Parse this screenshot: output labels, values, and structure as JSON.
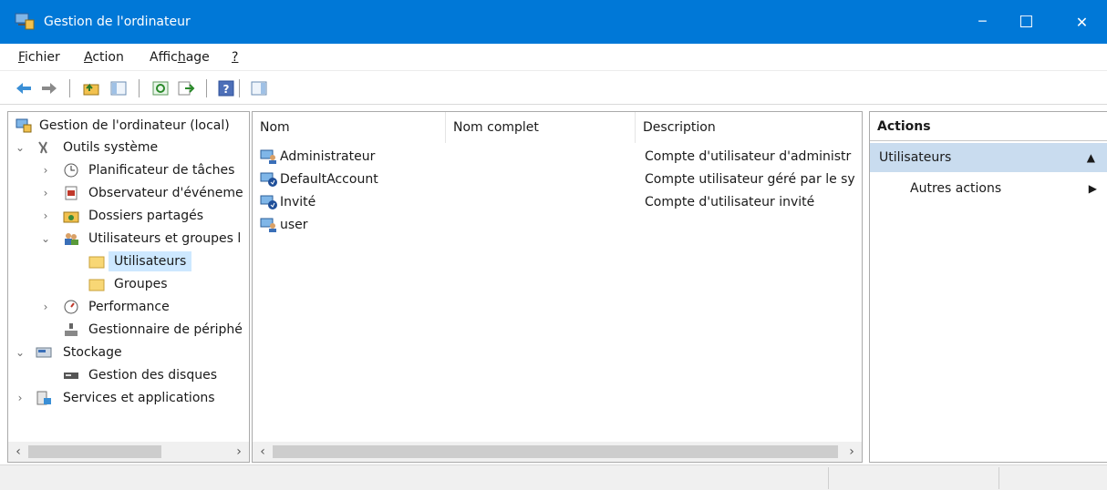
{
  "window": {
    "title": "Gestion de l'ordinateur",
    "min_glyph": "─",
    "max_glyph": "☐",
    "close_glyph": "✕"
  },
  "menu": [
    {
      "label": "Fichier",
      "mnemonic": "F",
      "rest": "ichier"
    },
    {
      "label": "Action",
      "mnemonic": "A",
      "rest": "ction"
    },
    {
      "label": "Affichage",
      "pre": "Affic",
      "mnemonic": "h",
      "rest": "age"
    },
    {
      "label": "?",
      "mnemonic": "?",
      "rest": ""
    }
  ],
  "toolbar": {
    "icons": [
      "back-icon",
      "forward-icon",
      "up-folder-icon",
      "show-hide-tree-icon",
      "refresh-icon",
      "export-list-icon",
      "help-icon",
      "show-hide-action-pane-icon"
    ]
  },
  "tree": {
    "nodes": [
      {
        "label": "Gestion de l'ordinateur (local)",
        "icon": "computer-management-icon",
        "expander": ""
      },
      {
        "label": "Outils système",
        "icon": "system-tools-icon",
        "expander": "⌄"
      },
      {
        "label": "Planificateur de tâches",
        "icon": "task-scheduler-icon",
        "expander": "›"
      },
      {
        "label": "Observateur d'événeme",
        "icon": "event-viewer-icon",
        "expander": "›"
      },
      {
        "label": "Dossiers partagés",
        "icon": "shared-folders-icon",
        "expander": "›"
      },
      {
        "label": "Utilisateurs et groupes l",
        "icon": "users-groups-icon",
        "expander": "⌄"
      },
      {
        "label": "Utilisateurs",
        "icon": "folder-icon",
        "expander": ""
      },
      {
        "label": "Groupes",
        "icon": "folder-icon",
        "expander": ""
      },
      {
        "label": "Performance",
        "icon": "performance-icon",
        "expander": "›"
      },
      {
        "label": "Gestionnaire de périphé",
        "icon": "device-manager-icon",
        "expander": ""
      },
      {
        "label": "Stockage",
        "icon": "storage-icon",
        "expander": "⌄"
      },
      {
        "label": "Gestion des disques",
        "icon": "disk-management-icon",
        "expander": ""
      },
      {
        "label": "Services et applications",
        "icon": "services-apps-icon",
        "expander": "›"
      }
    ],
    "scroll_left": "‹",
    "scroll_right": "›"
  },
  "list": {
    "columns": [
      "Nom",
      "Nom complet",
      "Description"
    ],
    "rows": [
      {
        "name": "Administrateur",
        "fullname": "",
        "description": "Compte d'utilisateur d'administr",
        "icon": "user-icon"
      },
      {
        "name": "DefaultAccount",
        "fullname": "",
        "description": "Compte utilisateur géré par le sy",
        "icon": "disabled-user-icon"
      },
      {
        "name": "Invité",
        "fullname": "",
        "description": "Compte d'utilisateur invité",
        "icon": "disabled-user-icon"
      },
      {
        "name": "user",
        "fullname": "",
        "description": "",
        "icon": "user-icon"
      }
    ],
    "scroll_left": "‹",
    "scroll_right": "›"
  },
  "actions": {
    "title": "Actions",
    "section": "Utilisateurs",
    "section_glyph": "▲",
    "item": "Autres actions",
    "item_glyph": "▶"
  },
  "colors": {
    "titlebar": "#0078d7",
    "selection": "#cde8ff",
    "section_bg": "#c9dcef"
  }
}
